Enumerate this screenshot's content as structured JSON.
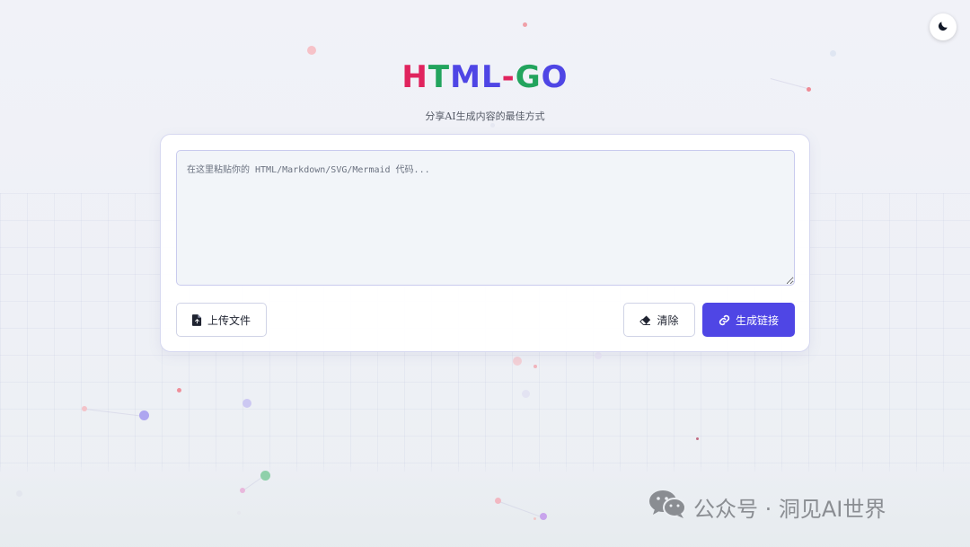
{
  "logo": {
    "letters": [
      {
        "char": "H",
        "color": "#e0245e"
      },
      {
        "char": "T",
        "color": "#22a45d"
      },
      {
        "char": "M",
        "color": "#4f46e5"
      },
      {
        "char": "L",
        "color": "#4f46e5"
      },
      {
        "char": "-",
        "color": "#e0245e"
      },
      {
        "char": "G",
        "color": "#22a45d"
      },
      {
        "char": "O",
        "color": "#4f46e5"
      }
    ]
  },
  "subtitle": "分享AI生成内容的最佳方式",
  "editor": {
    "placeholder": "在这里粘贴你的 HTML/Markdown/SVG/Mermaid 代码...",
    "value": ""
  },
  "buttons": {
    "upload_label": "上传文件",
    "clear_label": "清除",
    "generate_label": "生成链接"
  },
  "theme_toggle": {
    "icon": "moon-icon"
  },
  "watermark": {
    "text": "公众号 · 洞见AI世界",
    "icon": "wechat-icon"
  },
  "colors": {
    "accent": "#4f46e5",
    "background": "#f1f2f8"
  }
}
